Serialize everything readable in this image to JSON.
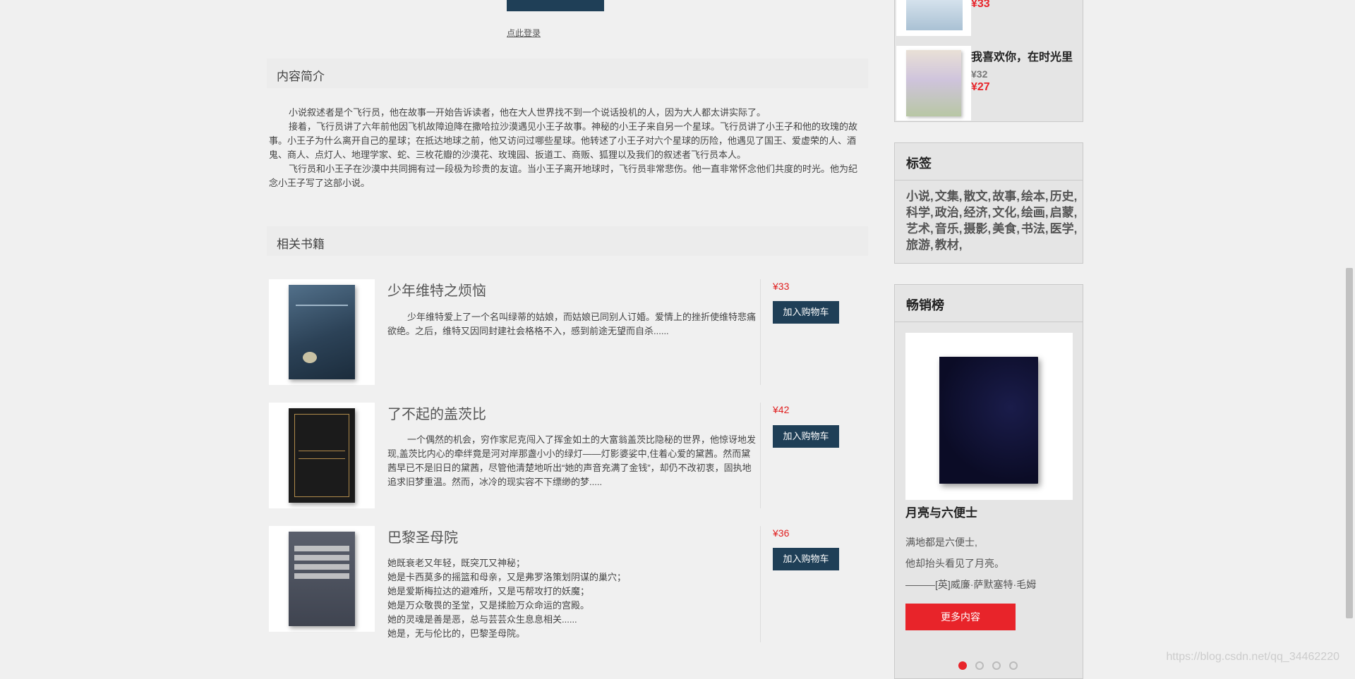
{
  "login": {
    "link_text": "点此登录"
  },
  "intro": {
    "heading": "内容简介",
    "paragraphs": [
      "小说叙述者是个飞行员，他在故事一开始告诉读者，他在大人世界找不到一个说话投机的人，因为大人都太讲实际了。",
      "接着，飞行员讲了六年前他因飞机故障迫降在撒哈拉沙漠遇见小王子故事。神秘的小王子来自另一个星球。飞行员讲了小王子和他的玫瑰的故事。小王子为什么离开自己的星球；在抵达地球之前，他又访问过哪些星球。他转述了小王子对六个星球的历险，他遇见了国王、爱虚荣的人、酒鬼、商人、点灯人、地理学家、蛇、三枚花瓣的沙漠花、玫瑰园、扳道工、商贩、狐狸以及我们的叙述者飞行员本人。",
      "飞行员和小王子在沙漠中共同拥有过一段极为珍贵的友谊。当小王子离开地球时，飞行员非常悲伤。他一直非常怀念他们共度的时光。他为纪念小王子写了这部小说。"
    ]
  },
  "related": {
    "heading": "相关书籍",
    "books": [
      {
        "title": "少年维特之烦恼",
        "desc": "少年维特爱上了一个名叫绿蒂的姑娘，而姑娘已同别人订婚。爱情上的挫折使维特悲痛欲绝。之后，维特又因同封建社会格格不入，感到前途无望而自杀......",
        "price": "¥33",
        "cart": "加入购物车"
      },
      {
        "title": "了不起的盖茨比",
        "desc": "一个偶然的机会，穷作家尼克闯入了挥金如土的大富翁盖茨比隐秘的世界，他惊讶地发现,盖茨比内心的牵绊竟是河对岸那盏小小的绿灯——灯影婆娑中,住着心爱的黛茜。然而黛茜早已不是旧日的黛茜，尽管他清楚地听出“她的声音充满了金钱”，却仍不改初衷，固执地追求旧梦重温。然而，冰冷的现实容不下缥缈的梦.....",
        "price": "¥42",
        "cart": "加入购物车"
      },
      {
        "title": "巴黎圣母院",
        "desc_lines": [
          "她既衰老又年轻，既突兀又神秘；",
          "她是卡西莫多的摇篮和母亲，又是弗罗洛策划阴谋的巢穴；",
          "她是爱斯梅拉达的避难所，又是丐帮攻打的妖魔；",
          "她是万众敬畏的圣堂，又是揉脸万众命运的宫殿。",
          "她的灵魂是善是恶，总与芸芸众生息息相关......",
          "她是，无与伦比的，巴黎圣母院。"
        ],
        "price": "¥36",
        "cart": "加入购物车"
      }
    ]
  },
  "sidebar": {
    "mini_list": [
      {
        "price_now": "¥33"
      },
      {
        "title": "我喜欢你，在时光里",
        "price_old": "¥32",
        "price_now": "¥27"
      }
    ],
    "tags": {
      "heading": "标签",
      "items": [
        "小说,",
        "文集,",
        "散文,",
        "故事,",
        "绘本,",
        "历史,",
        "科学,",
        "政治,",
        "经济,",
        "文化,",
        "绘画,",
        "启蒙,",
        "艺术,",
        "音乐,",
        "摄影,",
        "美食,",
        "书法,",
        "医学,",
        "旅游,",
        "教材,"
      ]
    },
    "bestseller": {
      "heading": "畅销榜",
      "title": "月亮与六便士",
      "quote_lines": [
        "满地都是六便士,",
        "他却抬头看见了月亮。",
        "———[英]威廉·萨默塞特·毛姆"
      ],
      "more": "更多内容",
      "dots": 4,
      "active_dot": 0
    }
  },
  "watermark": "https://blog.csdn.net/qq_34462220",
  "colors": {
    "navy": "#1f3f57",
    "red": "#e8242a",
    "price_red": "#e02020"
  }
}
